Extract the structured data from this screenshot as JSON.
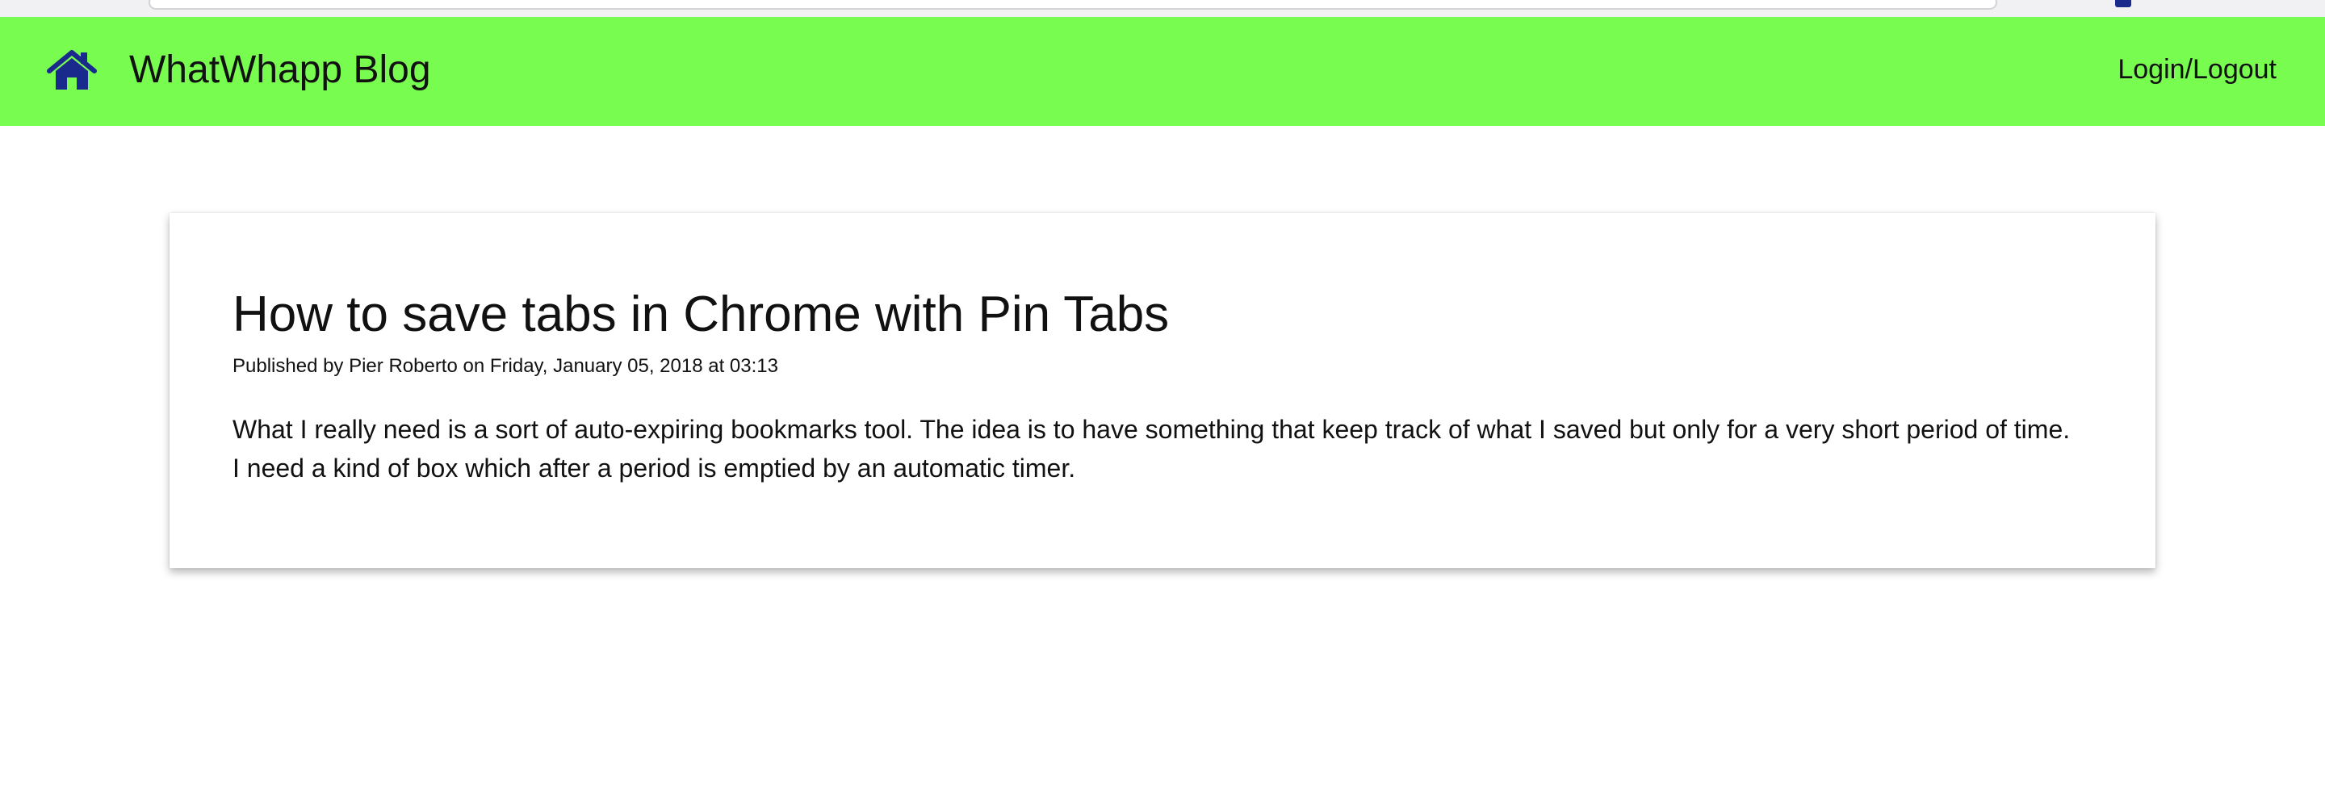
{
  "navbar": {
    "brand": "WhatWhapp Blog",
    "login_label": "Login/Logout",
    "home_icon": "home-icon",
    "background_color": "#77fc4f",
    "icon_color": "#1a2a8c"
  },
  "post": {
    "title": "How to save tabs in Chrome with Pin Tabs",
    "meta": "Published by Pier Roberto on Friday, January 05, 2018 at 03:13",
    "body": "What I really need is a sort of auto-expiring bookmarks tool. The idea is to have something that keep track of what I saved but only for a very short period of time. I need a kind of box which after a period is emptied by an automatic timer."
  }
}
